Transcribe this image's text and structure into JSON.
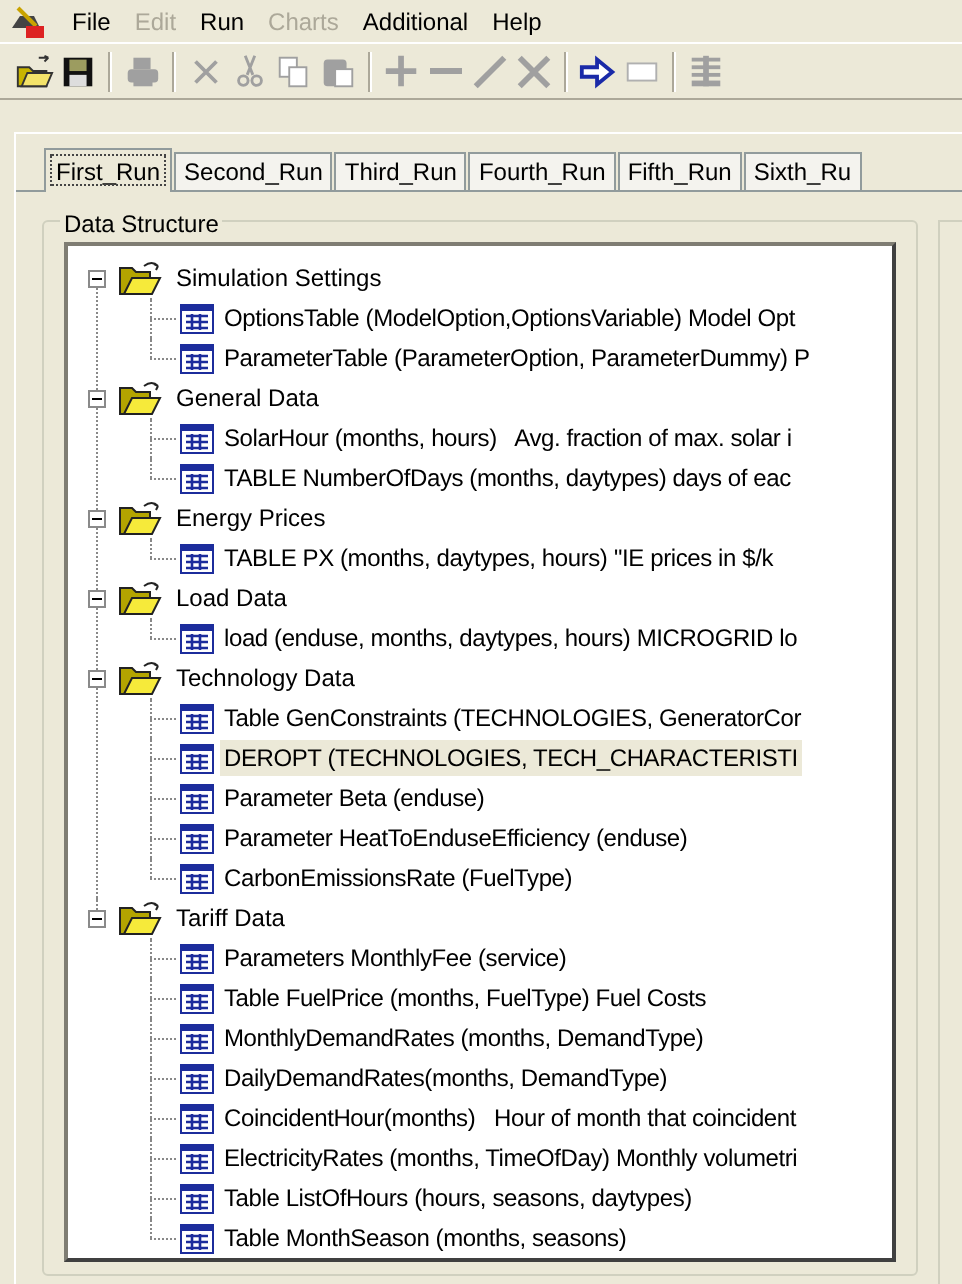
{
  "menu": [
    {
      "label": "File",
      "disabled": false
    },
    {
      "label": "Edit",
      "disabled": true
    },
    {
      "label": "Run",
      "disabled": false
    },
    {
      "label": "Charts",
      "disabled": true
    },
    {
      "label": "Additional",
      "disabled": false
    },
    {
      "label": "Help",
      "disabled": false
    }
  ],
  "toolbar_groups": [
    [
      {
        "kind": "open",
        "disabled": false
      },
      {
        "kind": "save",
        "disabled": false
      }
    ],
    [
      {
        "kind": "print",
        "disabled": true
      }
    ],
    [
      {
        "kind": "delete",
        "disabled": true
      },
      {
        "kind": "cut",
        "disabled": true
      },
      {
        "kind": "copy",
        "disabled": true
      },
      {
        "kind": "paste",
        "disabled": true
      }
    ],
    [
      {
        "kind": "add",
        "disabled": true
      },
      {
        "kind": "remove",
        "disabled": true
      },
      {
        "kind": "line",
        "disabled": true
      },
      {
        "kind": "cross",
        "disabled": true
      }
    ],
    [
      {
        "kind": "arrow",
        "disabled": false
      },
      {
        "kind": "rect",
        "disabled": true
      }
    ],
    [
      {
        "kind": "grid",
        "disabled": true
      }
    ]
  ],
  "tabs": [
    {
      "label": "First_Run",
      "selected": true
    },
    {
      "label": "Second_Run",
      "selected": false
    },
    {
      "label": "Third_Run",
      "selected": false
    },
    {
      "label": "Fourth_Run",
      "selected": false
    },
    {
      "label": "Fifth_Run",
      "selected": false
    },
    {
      "label": "Sixth_Ru",
      "selected": false
    }
  ],
  "group_title": "Data Structure",
  "tree": [
    {
      "label": "Simulation Settings",
      "expanded": true,
      "children": [
        {
          "label": "OptionsTable (ModelOption,OptionsVariable) Model Opt",
          "selected": false
        },
        {
          "label": "ParameterTable (ParameterOption, ParameterDummy) P",
          "selected": false
        }
      ]
    },
    {
      "label": "General Data",
      "expanded": true,
      "children": [
        {
          "label": "SolarHour (months, hours)   Avg. fraction of max. solar i",
          "selected": false
        },
        {
          "label": "TABLE NumberOfDays (months, daytypes) days of eac",
          "selected": false
        }
      ]
    },
    {
      "label": "Energy Prices",
      "expanded": true,
      "children": [
        {
          "label": "TABLE PX (months, daytypes, hours) ''IE prices in $/k",
          "selected": false
        }
      ]
    },
    {
      "label": "Load Data",
      "expanded": true,
      "children": [
        {
          "label": "load (enduse, months, daytypes, hours) MICROGRID lo",
          "selected": false
        }
      ]
    },
    {
      "label": "Technology Data",
      "expanded": true,
      "children": [
        {
          "label": "Table GenConstraints (TECHNOLOGIES, GeneratorCor",
          "selected": false
        },
        {
          "label": "DEROPT (TECHNOLOGIES, TECH_CHARACTERISTI",
          "selected": true
        },
        {
          "label": "Parameter Beta (enduse)",
          "selected": false
        },
        {
          "label": "Parameter HeatToEnduseEfficiency (enduse)",
          "selected": false
        },
        {
          "label": "CarbonEmissionsRate (FuelType)",
          "selected": false
        }
      ]
    },
    {
      "label": "Tariff Data",
      "expanded": true,
      "children": [
        {
          "label": "Parameters MonthlyFee (service)",
          "selected": false
        },
        {
          "label": "Table FuelPrice (months, FuelType) Fuel Costs",
          "selected": false
        },
        {
          "label": "MonthlyDemandRates (months, DemandType)",
          "selected": false
        },
        {
          "label": "DailyDemandRates(months, DemandType)",
          "selected": false
        },
        {
          "label": "CoincidentHour(months)   Hour of month that coincident",
          "selected": false
        },
        {
          "label": "ElectricityRates (months, TimeOfDay) Monthly volumetri",
          "selected": false
        },
        {
          "label": "Table ListOfHours (hours, seasons, daytypes)",
          "selected": false
        },
        {
          "label": "Table MonthSeason (months, seasons)",
          "selected": false
        }
      ]
    }
  ]
}
